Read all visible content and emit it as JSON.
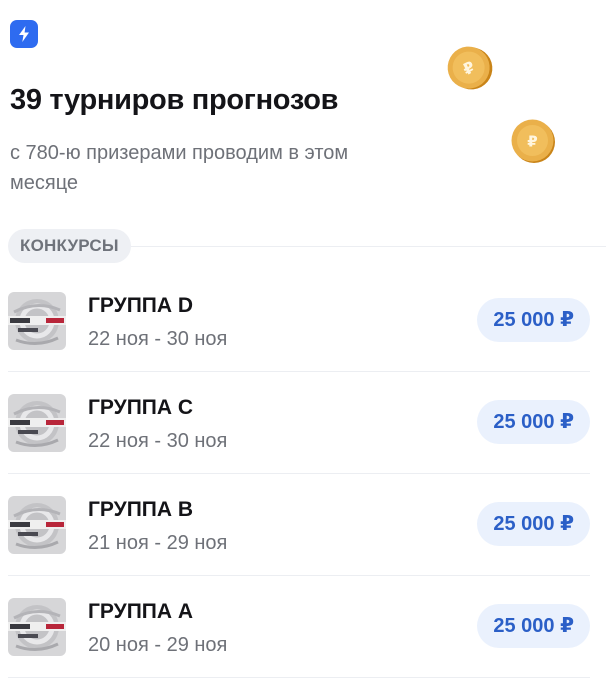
{
  "header": {
    "badge_icon": "lightning-bolt-icon",
    "title": "39 турниров прогнозов",
    "subtitle": "с 780-ю призерами проводим в этом месяце"
  },
  "decor": {
    "coin_icon": "ruble-coin-icon"
  },
  "section": {
    "label": "КОНКУРСЫ"
  },
  "contests": [
    {
      "title": "ГРУППА D",
      "dates": "22 ноя - 30 ноя",
      "prize": "25 000 ₽"
    },
    {
      "title": "ГРУППА C",
      "dates": "22 ноя - 30 ноя",
      "prize": "25 000 ₽"
    },
    {
      "title": "ГРУППА B",
      "dates": "21 ноя - 29 ноя",
      "prize": "25 000 ₽"
    },
    {
      "title": "ГРУППА A",
      "dates": "20 ноя - 29 ноя",
      "prize": "25 000 ₽"
    }
  ],
  "colors": {
    "accent": "#2e6bf0",
    "prize_text": "#2b5fc7",
    "prize_bg": "#eaf1fd",
    "coin": "#e6a83a"
  }
}
